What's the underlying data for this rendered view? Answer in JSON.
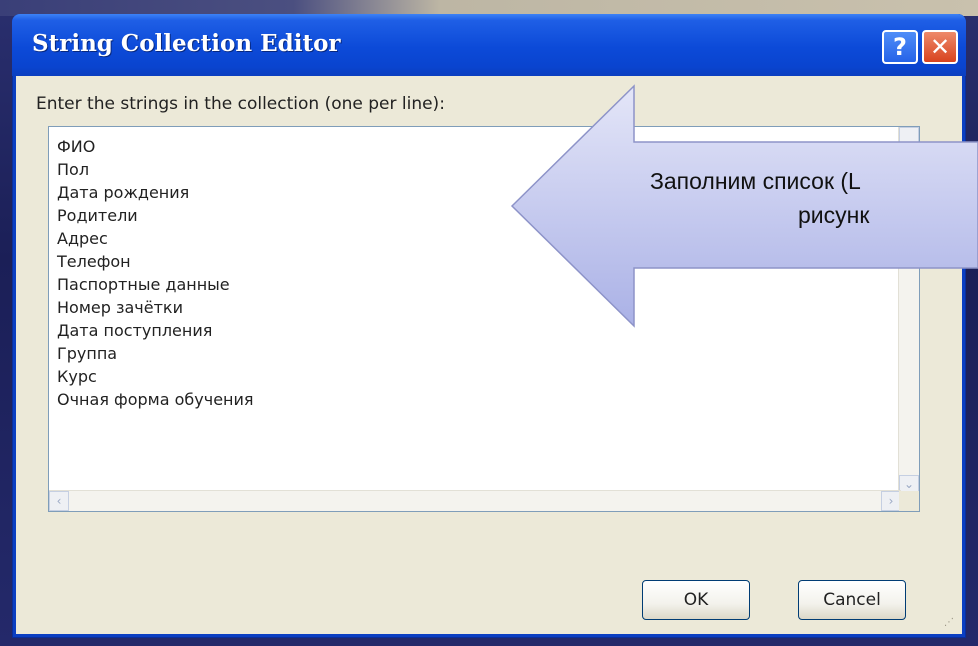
{
  "window": {
    "title": "String Collection Editor",
    "help_label": "?",
    "close_label": "✕"
  },
  "editor": {
    "prompt": "Enter the strings in the collection (one per line):",
    "lines": [
      "ФИО",
      "Пол",
      "Дата рождения",
      "Родители",
      "Адрес",
      "Телефон",
      "Паспортные данные",
      "Номер зачётки",
      "Дата поступления",
      "Группа",
      "Курс",
      "Очная форма обучения"
    ]
  },
  "buttons": {
    "ok": "OK",
    "cancel": "Cancel"
  },
  "callout": {
    "line1": "Заполним список (L",
    "line2": "рисунк"
  },
  "colors": {
    "title_bar": "#0a44cf",
    "client_bg": "#ece9d8",
    "arrow_fill": "#c8cdf0"
  },
  "icons": {
    "help": "help-icon",
    "close": "close-icon",
    "scroll_up": "chevron-up-icon",
    "scroll_down": "chevron-down-icon",
    "scroll_left": "chevron-left-icon",
    "scroll_right": "chevron-right-icon",
    "resize": "resize-grip-icon",
    "arrow": "arrow-left-icon"
  }
}
